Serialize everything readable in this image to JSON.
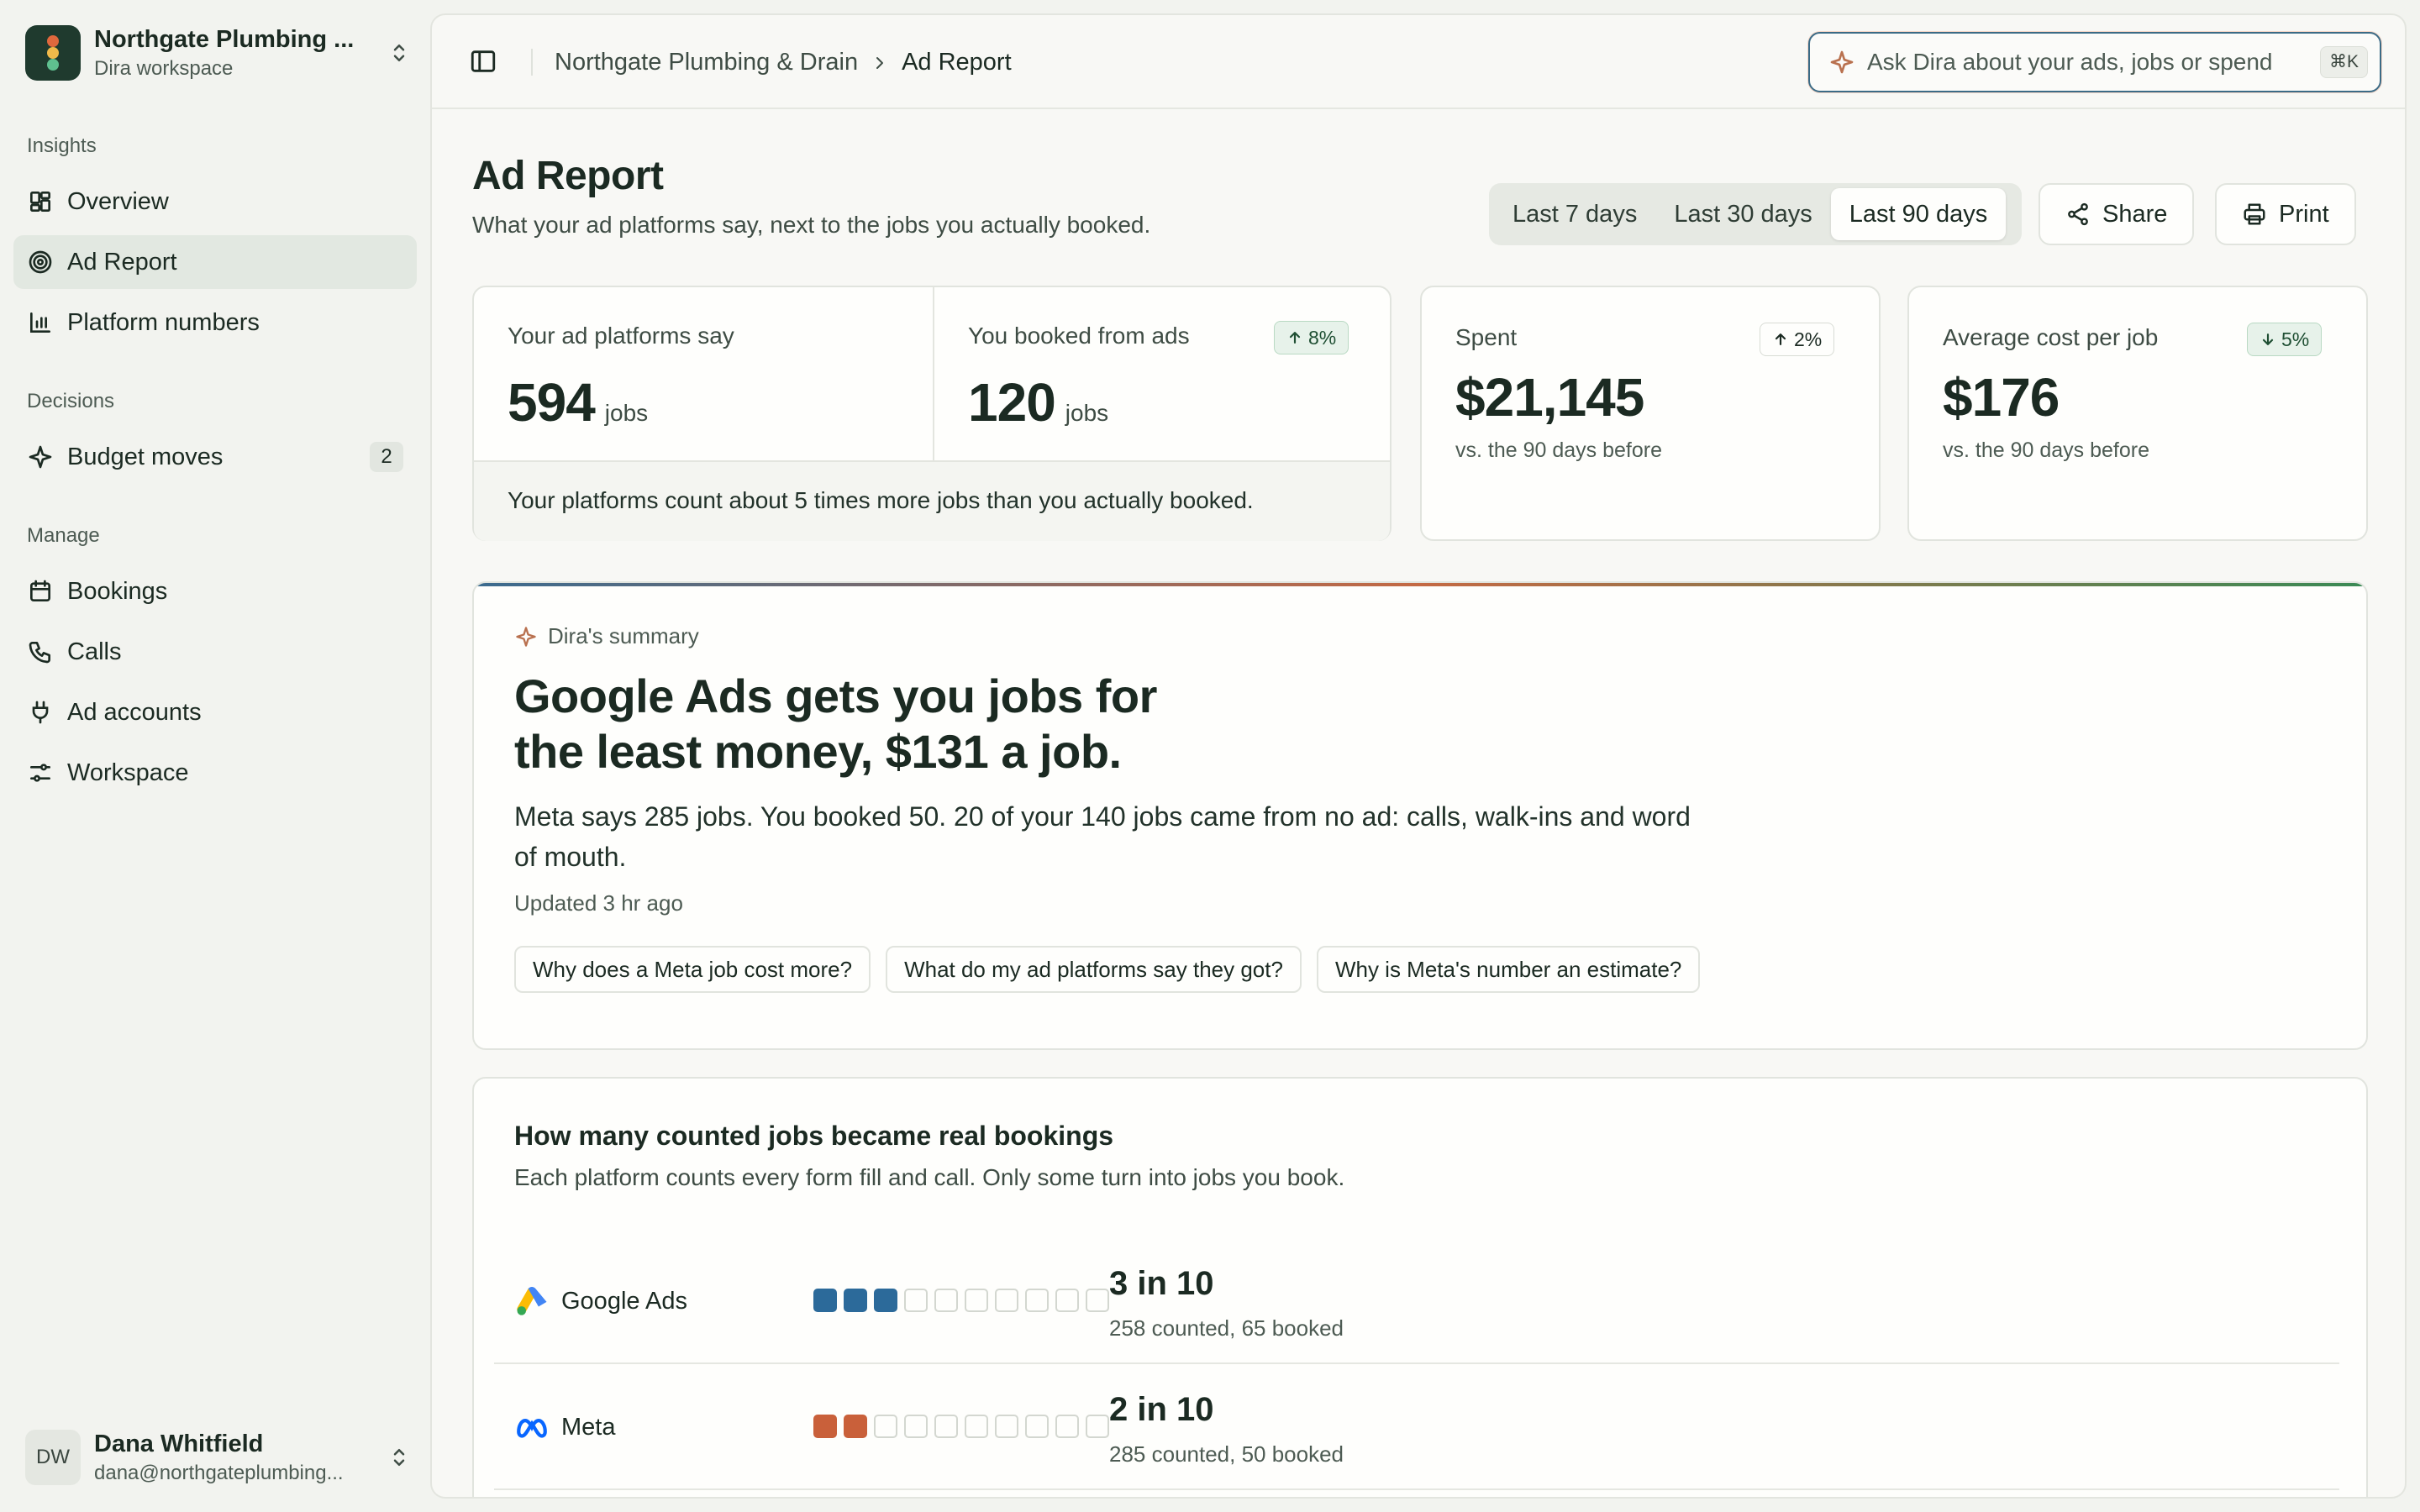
{
  "workspace": {
    "name": "Northgate Plumbing ...",
    "subtitle": "Dira workspace"
  },
  "sidebar": {
    "groups": [
      {
        "label": "Insights",
        "items": [
          {
            "label": "Overview",
            "icon": "grid-icon"
          },
          {
            "label": "Ad Report",
            "icon": "target-icon",
            "active": true
          },
          {
            "label": "Platform numbers",
            "icon": "bar-chart-icon"
          }
        ]
      },
      {
        "label": "Decisions",
        "items": [
          {
            "label": "Budget moves",
            "icon": "sparkle-icon",
            "badge": "2"
          }
        ]
      },
      {
        "label": "Manage",
        "items": [
          {
            "label": "Bookings",
            "icon": "calendar-icon"
          },
          {
            "label": "Calls",
            "icon": "phone-icon"
          },
          {
            "label": "Ad accounts",
            "icon": "plug-icon"
          },
          {
            "label": "Workspace",
            "icon": "sliders-icon"
          }
        ]
      }
    ]
  },
  "user": {
    "initials": "DW",
    "name": "Dana Whitfield",
    "email": "dana@northgateplumbing..."
  },
  "header": {
    "breadcrumb_parent": "Northgate Plumbing & Drain",
    "breadcrumb_current": "Ad Report",
    "ask_placeholder": "Ask Dira about your ads, jobs or spend",
    "shortcut": "⌘K"
  },
  "page": {
    "title": "Ad Report",
    "subtitle": "What your ad platforms say, next to the jobs you actually booked.",
    "ranges": [
      "Last 7 days",
      "Last 30 days",
      "Last 90 days"
    ],
    "active_range": "Last 90 days",
    "share_label": "Share",
    "print_label": "Print"
  },
  "stats": {
    "platforms_say": {
      "label": "Your ad platforms say",
      "value": "594",
      "unit": "jobs"
    },
    "booked": {
      "label": "You booked from ads",
      "value": "120",
      "unit": "jobs",
      "delta": "8%",
      "direction": "up"
    },
    "comparison_note": "Your platforms count about 5 times more jobs than you actually booked.",
    "spent": {
      "label": "Spent",
      "value": "$21,145",
      "delta": "2%",
      "direction": "up",
      "note": "vs. the 90 days before"
    },
    "cost_per_job": {
      "label": "Average cost per job",
      "value": "$176",
      "delta": "5%",
      "direction": "down",
      "note": "vs. the 90 days before"
    }
  },
  "summary": {
    "label": "Dira's summary",
    "headline": "Google Ads gets you jobs for the least money, $131 a job.",
    "body": "Meta says 285 jobs. You booked 50. 20 of your 140 jobs came from no ad: calls, walk-ins and word of mouth.",
    "updated": "Updated 3 hr ago",
    "questions": [
      "Why does a Meta job cost more?",
      "What do my ad platforms say they got?",
      "Why is Meta's number an estimate?"
    ]
  },
  "conversion": {
    "title": "How many counted jobs became real bookings",
    "subtitle": "Each platform counts every form fill and call. Only some turn into jobs you book.",
    "rows": [
      {
        "platform": "Google Ads",
        "icon": "google-ads-icon",
        "filled": 3,
        "total": 10,
        "color": "#2c6a9a",
        "ratio": "3 in 10",
        "detail": "258 counted, 65 booked"
      },
      {
        "platform": "Meta",
        "icon": "meta-icon",
        "filled": 2,
        "total": 10,
        "color": "#c9603a",
        "ratio": "2 in 10",
        "detail": "285 counted, 50 booked"
      }
    ]
  }
}
